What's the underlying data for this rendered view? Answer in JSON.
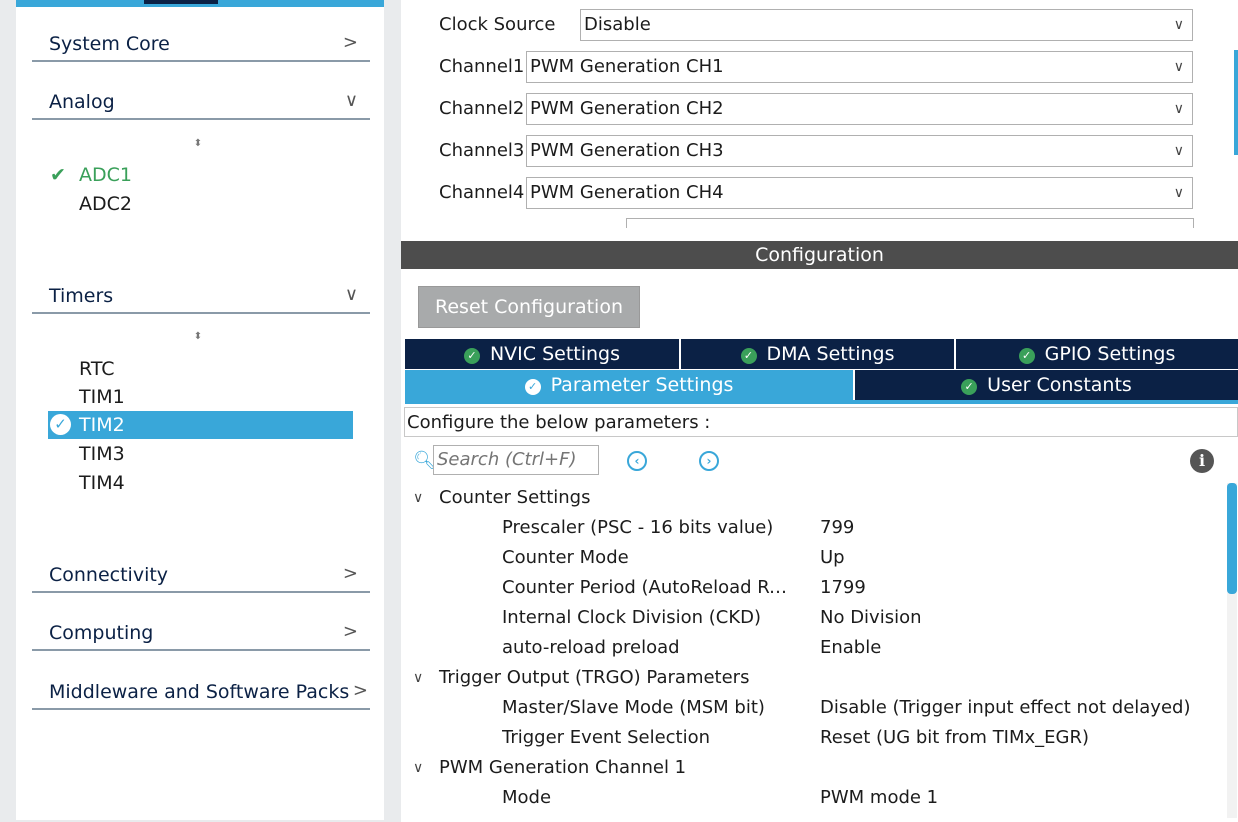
{
  "sidebar": {
    "categories": [
      {
        "label": "System Core",
        "chevron": ">"
      },
      {
        "label": "Analog",
        "chevron": "∨"
      },
      {
        "label": "Timers",
        "chevron": "∨"
      },
      {
        "label": "Connectivity",
        "chevron": ">"
      },
      {
        "label": "Computing",
        "chevron": ">"
      },
      {
        "label": "Middleware and Software Packs",
        "chevron": ">"
      }
    ],
    "analog_items": [
      "ADC1",
      "ADC2"
    ],
    "timer_items": [
      "RTC",
      "TIM1",
      "TIM2",
      "TIM3",
      "TIM4"
    ],
    "selected": "TIM2",
    "sort_icon": "⬍"
  },
  "mode": {
    "clock_source": {
      "label": "Clock Source",
      "value": "Disable"
    },
    "channels": [
      {
        "label": "Channel1",
        "value": "PWM Generation CH1"
      },
      {
        "label": "Channel2",
        "value": "PWM Generation CH2"
      },
      {
        "label": "Channel3",
        "value": "PWM Generation CH3"
      },
      {
        "label": "Channel4",
        "value": "PWM Generation CH4"
      }
    ],
    "dropdown_arrow": "∨"
  },
  "config": {
    "header": "Configuration",
    "reset_button": "Reset Configuration",
    "tabs_row1": [
      "NVIC Settings",
      "DMA Settings",
      "GPIO Settings"
    ],
    "tabs_row2": [
      "Parameter Settings",
      "User Constants"
    ],
    "active_tab": "Parameter Settings",
    "description": "Configure the below parameters :",
    "search_placeholder": "Search (Ctrl+F)",
    "groups": [
      {
        "name": "Counter Settings",
        "params": [
          {
            "name": "Prescaler (PSC - 16 bits value)",
            "value": "799"
          },
          {
            "name": "Counter Mode",
            "value": "Up"
          },
          {
            "name": "Counter Period (AutoReload Regi...",
            "value": "1799"
          },
          {
            "name": "Internal Clock Division (CKD)",
            "value": "No Division"
          },
          {
            "name": "auto-reload preload",
            "value": "Enable"
          }
        ]
      },
      {
        "name": "Trigger Output (TRGO) Parameters",
        "params": [
          {
            "name": "Master/Slave Mode (MSM bit)",
            "value": "Disable (Trigger input effect not delayed)"
          },
          {
            "name": "Trigger Event Selection",
            "value": "Reset (UG bit from TIMx_EGR)"
          }
        ]
      },
      {
        "name": "PWM Generation Channel 1",
        "params": [
          {
            "name": "Mode",
            "value": "PWM mode 1"
          }
        ]
      }
    ]
  },
  "colors": {
    "accent": "#39a7d9",
    "navy": "#0b2145",
    "green": "#3aa05a"
  }
}
